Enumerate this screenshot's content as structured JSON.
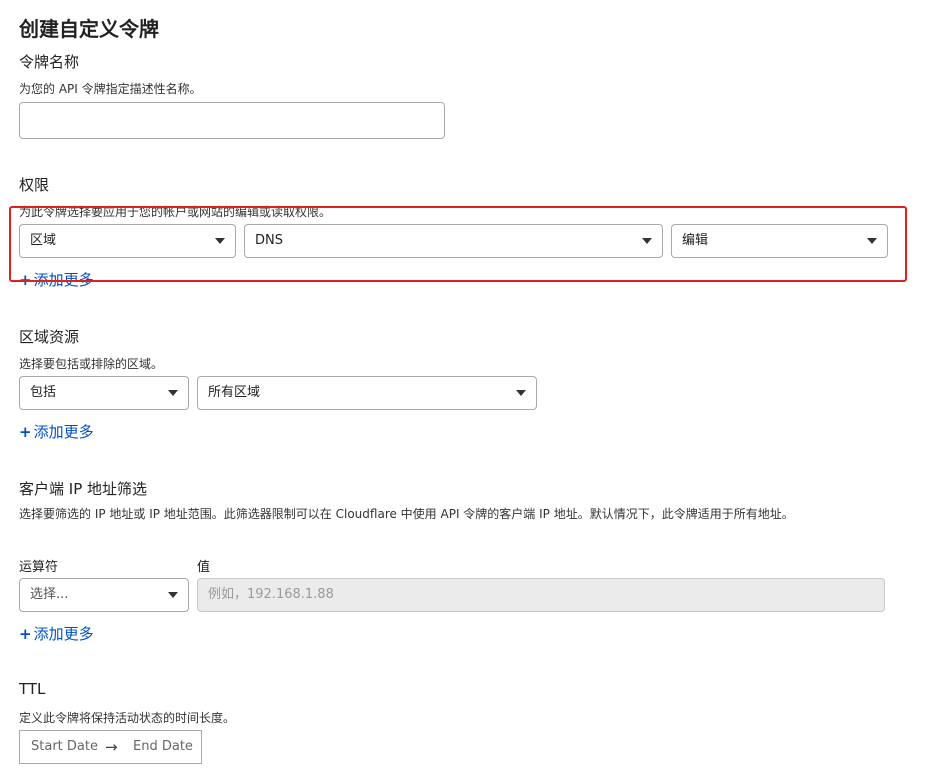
{
  "page_title": "创建自定义令牌",
  "token_name": {
    "title": "令牌名称",
    "description": "为您的 API 令牌指定描述性名称。",
    "value": ""
  },
  "permissions": {
    "title": "权限",
    "description": "为此令牌选择要应用于您的帐户或网站的编辑或读取权限。",
    "scope_value": "区域",
    "resource_value": "DNS",
    "access_value": "编辑",
    "add_more": "添加更多"
  },
  "zone_resources": {
    "title": "区域资源",
    "description": "选择要包括或排除的区域。",
    "include_value": "包括",
    "zone_value": "所有区域",
    "add_more": "添加更多"
  },
  "ip_filter": {
    "title": "客户端 IP 地址筛选",
    "description": "选择要筛选的 IP 地址或 IP 地址范围。此筛选器限制可以在 Cloudflare 中使用 API 令牌的客户端 IP 地址。默认情况下，此令牌适用于所有地址。",
    "operator_label": "运算符",
    "operator_placeholder": "选择...",
    "value_label": "值",
    "value_placeholder": "例如，192.168.1.88",
    "add_more": "添加更多"
  },
  "ttl": {
    "title": "TTL",
    "description": "定义此令牌将保持活动状态的时间长度。",
    "start_placeholder": "Start Date",
    "arrow": "→",
    "end_placeholder": "End Date"
  },
  "icons": {
    "plus": "+"
  },
  "colors": {
    "link": "#0051c3",
    "highlight": "#e0201c",
    "border": "#a9a9a9",
    "disabled_bg": "#ebebeb"
  }
}
